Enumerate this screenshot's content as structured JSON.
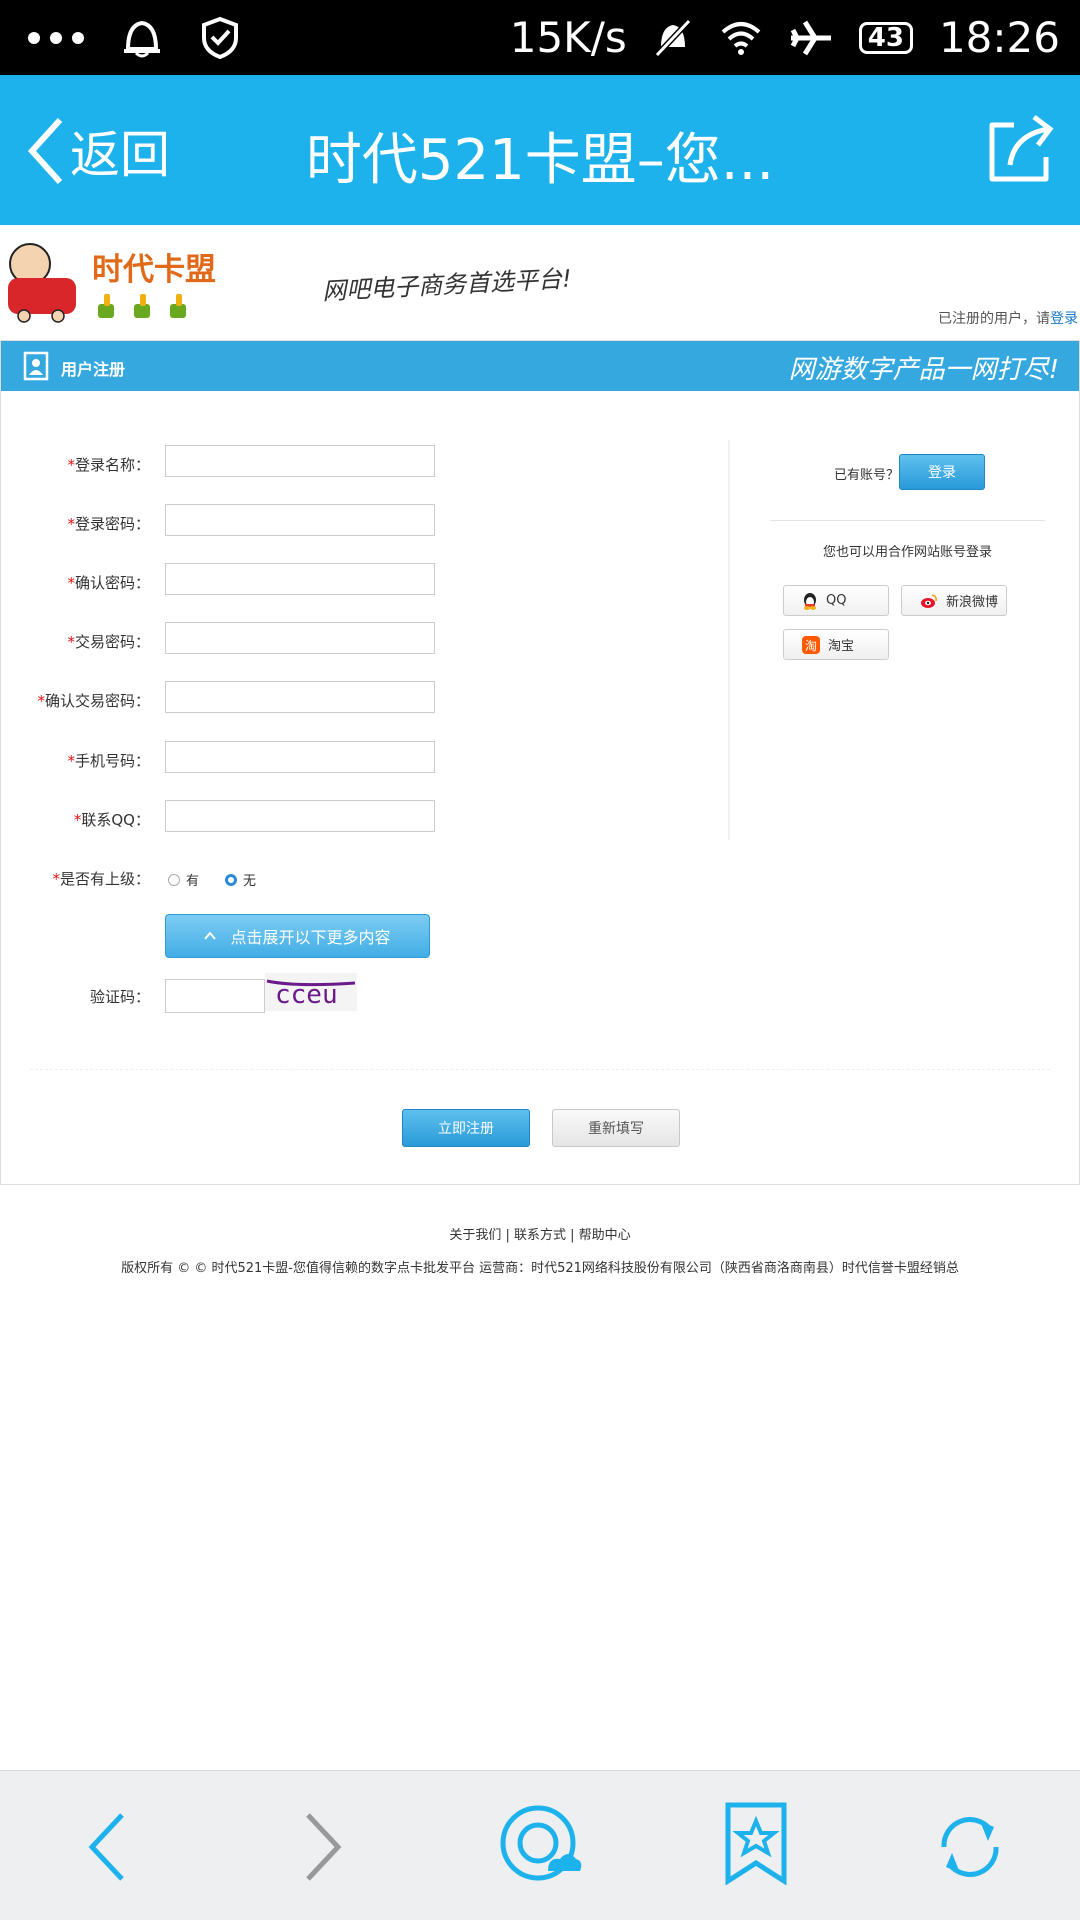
{
  "status_bar": {
    "net_speed": "15K/s",
    "battery": "43",
    "time": "18:26"
  },
  "nav": {
    "back_label": "返回",
    "title": "时代521卡盟–您..."
  },
  "site": {
    "logo_text": "时代卡盟",
    "slogan": "网吧电子商务首选平台!",
    "login_hint": "已注册的用户，请",
    "login_link": "登录"
  },
  "form": {
    "header_title": "用户注册",
    "header_slogan": "网游数字产品一网打尽!",
    "required_mark": "*",
    "fields": [
      {
        "label": "登录名称："
      },
      {
        "label": "登录密码："
      },
      {
        "label": "确认密码："
      },
      {
        "label": "交易密码："
      },
      {
        "label": "确认交易密码："
      },
      {
        "label": "手机号码："
      },
      {
        "label": "联系QQ："
      }
    ],
    "superior": {
      "label": "是否有上级：",
      "options": [
        "有",
        "无"
      ],
      "selected": "无"
    },
    "expand_label": "点击展开以下更多内容",
    "captcha_label": "验证码：",
    "captcha_text": "cceu",
    "submit_label": "立即注册",
    "reset_label": "重新填写"
  },
  "side": {
    "has_account": "已有账号？",
    "login_button": "登录",
    "partner_hint": "您也可以用合作网站账号登录",
    "partners": [
      "QQ",
      "新浪微博",
      "淘宝"
    ]
  },
  "footer": {
    "links": "关于我们 | 联系方式 | 帮助中心",
    "copyright": "版权所有 © © 时代521卡盟-您值得信赖的数字点卡批发平台  运营商：时代521网络科技股份有限公司（陕西省商洛商南县）时代信誉卡盟经销总"
  },
  "colors": {
    "accent": "#1eb2ec",
    "form_header": "#36a8e0",
    "required": "#e01010",
    "link": "#1878c8"
  }
}
